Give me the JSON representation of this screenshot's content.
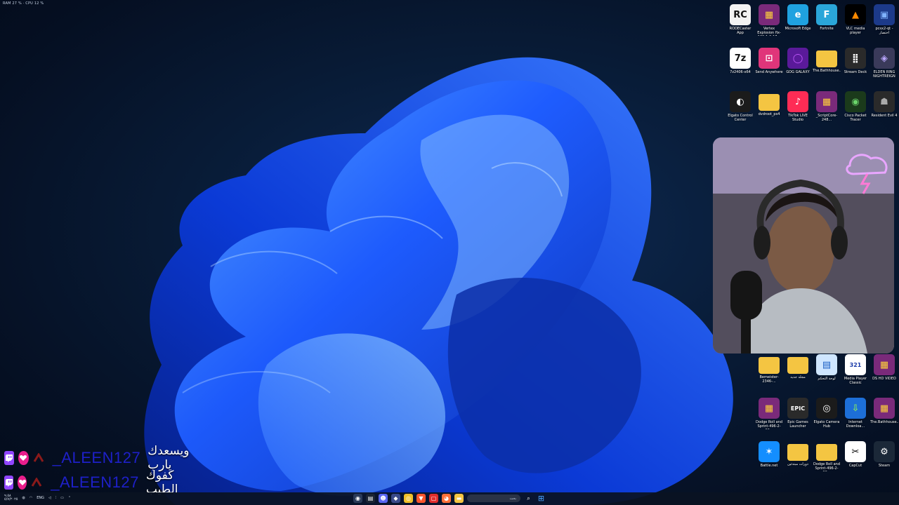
{
  "perf_overlay": "RAM 27 % · CPU 12 %",
  "desktop_icons": [
    {
      "label": "RODECaster App",
      "icon": "rodecaster-icon",
      "bg": "#f2f2f2",
      "glyph": "RC",
      "fg": "#111111"
    },
    {
      "label": "Vertex Explosion fix-109-1-0-17...",
      "icon": "winrar-icon",
      "bg": "#7a2a7a",
      "glyph": "▦",
      "fg": "#ffd23a"
    },
    {
      "label": "Microsoft Edge",
      "icon": "edge-icon",
      "bg": "#1fa2e0",
      "glyph": "e",
      "fg": "#ffffff"
    },
    {
      "label": "Fortnite",
      "icon": "fortnite-icon",
      "bg": "#2aa6d9",
      "glyph": "F",
      "fg": "#ffffff"
    },
    {
      "label": "VLC media player",
      "icon": "vlc-icon",
      "bg": "#000000",
      "glyph": "▲",
      "fg": "#ff8a00"
    },
    {
      "label": "pcsx2-qt - اختصار",
      "icon": "pcsx2-icon",
      "bg": "#1c3a8a",
      "glyph": "▣",
      "fg": "#7fb2ff"
    },
    {
      "label": "7z2406-x64",
      "icon": "7zip-icon",
      "bg": "#ffffff",
      "glyph": "7z",
      "fg": "#111111"
    },
    {
      "label": "Send Anywhere",
      "icon": "send-anywhere-icon",
      "bg": "#e0357a",
      "glyph": "⊡",
      "fg": "#ffffff"
    },
    {
      "label": "GOG GALAXY",
      "icon": "gog-galaxy-icon",
      "bg": "#5a1a9a",
      "glyph": "◯",
      "fg": "#c35bff"
    },
    {
      "label": "The.Bathhouse...",
      "icon": "folder-icon",
      "bg": "#f4c542",
      "glyph": "",
      "fg": "#ffffff"
    },
    {
      "label": "Stream Deck",
      "icon": "stream-deck-icon",
      "bg": "#2a2a2a",
      "glyph": "⣿",
      "fg": "#ffffff"
    },
    {
      "label": "ELDEN RING NIGHTREIGN",
      "icon": "elden-ring-icon",
      "bg": "#3a3a5a",
      "glyph": "◈",
      "fg": "#b9a6ff"
    },
    {
      "label": "Elgato Control Center",
      "icon": "elgato-control-icon",
      "bg": "#1b1b1b",
      "glyph": "◐",
      "fg": "#ffffff"
    },
    {
      "label": "dvdroot_ps4",
      "icon": "folder-icon",
      "bg": "#f4c542",
      "glyph": "",
      "fg": "#ffffff"
    },
    {
      "label": "TikTok LIVE Studio",
      "icon": "tiktok-icon",
      "bg": "#fe2c55",
      "glyph": "♪",
      "fg": "#ffffff"
    },
    {
      "label": "_ScriptCore-248...",
      "icon": "winrar-icon",
      "bg": "#7a2a7a",
      "glyph": "▦",
      "fg": "#ffd23a"
    },
    {
      "label": "Cisco Packet Tracer",
      "icon": "cisco-icon",
      "bg": "#1b3a1b",
      "glyph": "◉",
      "fg": "#6ad36a"
    },
    {
      "label": "Resident Evil 4",
      "icon": "re4-icon",
      "bg": "#2a2a2a",
      "glyph": "☗",
      "fg": "#aaaaaa"
    },
    {
      "label": "Bemeister-2346-...",
      "icon": "folder-icon",
      "bg": "#f4c542",
      "glyph": "",
      "fg": "#ffffff"
    },
    {
      "label": "مجلد جديد",
      "icon": "folder-icon",
      "bg": "#f4c542",
      "glyph": "",
      "fg": "#ffffff"
    },
    {
      "label": "لوحة التحكم",
      "icon": "control-panel-icon",
      "bg": "#cfe6ff",
      "glyph": "▤",
      "fg": "#1a5ec4"
    },
    {
      "label": "Media Player Classic",
      "icon": "mpc-icon",
      "bg": "#ffffff",
      "glyph": "321",
      "fg": "#1a3aa8"
    },
    {
      "label": "DS HD VIDEO",
      "icon": "winrar-icon",
      "bg": "#7a2a7a",
      "glyph": "▦",
      "fg": "#ffd23a"
    },
    {
      "label": "Dodge Roll and Sprint-496-2-30...",
      "icon": "winrar-icon",
      "bg": "#7a2a7a",
      "glyph": "▦",
      "fg": "#ffd23a"
    },
    {
      "label": "Epic Games Launcher",
      "icon": "epic-games-icon",
      "bg": "#2a2a2a",
      "glyph": "EPIC",
      "fg": "#ffffff"
    },
    {
      "label": "Elgato Camera Hub",
      "icon": "elgato-camera-icon",
      "bg": "#1b1b1b",
      "glyph": "◎",
      "fg": "#ffffff"
    },
    {
      "label": "Internet Downloa...",
      "icon": "idm-icon",
      "bg": "#1d6fd8",
      "glyph": "⇩",
      "fg": "#7ee06b"
    },
    {
      "label": "The.Bathhouse...",
      "icon": "winrar-icon",
      "bg": "#7a2a7a",
      "glyph": "▦",
      "fg": "#ffd23a"
    },
    {
      "label": "Battle.net",
      "icon": "battlenet-icon",
      "bg": "#148eff",
      "glyph": "✶",
      "fg": "#ffffff"
    },
    {
      "label": "دورات مبتدئين",
      "icon": "folder-icon",
      "bg": "#f4c542",
      "glyph": "",
      "fg": "#ffffff"
    },
    {
      "label": "Dodge Roll and Sprint-496-2-30...",
      "icon": "folder-icon",
      "bg": "#f4c542",
      "glyph": "",
      "fg": "#ffffff"
    },
    {
      "label": "CapCut",
      "icon": "capcut-icon",
      "bg": "#ffffff",
      "glyph": "✂",
      "fg": "#000000"
    },
    {
      "label": "Steam",
      "icon": "steam-icon",
      "bg": "#1b2838",
      "glyph": "⚙",
      "fg": "#ffffff"
    }
  ],
  "chat": [
    {
      "username": "_ALEEN127",
      "message": "ويسعدك يارب"
    },
    {
      "username": "_ALEEN127",
      "message": "كفوك الطيب"
    }
  ],
  "taskbar": {
    "search_placeholder": "بحث",
    "language": "ENG",
    "clock_time": "٩:٥٨",
    "clock_date": "٥/٧/٢٠٢٥"
  }
}
